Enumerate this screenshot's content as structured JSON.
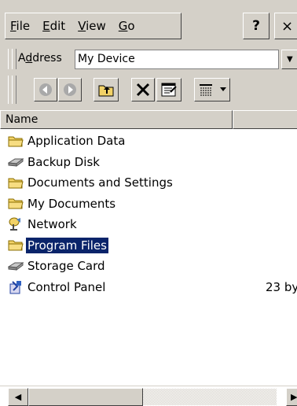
{
  "menu": {
    "items": [
      {
        "mnemonic": "F",
        "rest": "ile"
      },
      {
        "mnemonic": "E",
        "rest": "dit"
      },
      {
        "mnemonic": "V",
        "rest": "iew"
      },
      {
        "mnemonic": "G",
        "rest": "o"
      }
    ],
    "help_label": "?",
    "close_label": "×"
  },
  "address": {
    "label_prefix": "A",
    "label_mnemonic": "d",
    "label_rest": "dress",
    "value": "My Device",
    "dropdown_icon": "▼"
  },
  "toolbar": {
    "back_icon": "left-arrow-icon",
    "forward_icon": "right-arrow-icon",
    "up_icon": "folder-up-icon",
    "delete_icon": "delete-x-icon",
    "properties_icon": "properties-icon",
    "views_icon": "details-view-icon"
  },
  "columns": {
    "name": "Name",
    "size": ""
  },
  "files": [
    {
      "name": "Application Data",
      "icon": "folder-icon",
      "size": ""
    },
    {
      "name": "Backup Disk",
      "icon": "storage-card-icon",
      "size": ""
    },
    {
      "name": "Documents and Settings",
      "icon": "folder-icon",
      "size": ""
    },
    {
      "name": "My Documents",
      "icon": "folder-icon",
      "size": ""
    },
    {
      "name": "Network",
      "icon": "network-icon",
      "size": ""
    },
    {
      "name": "Program Files",
      "icon": "folder-icon",
      "size": "",
      "selected": true
    },
    {
      "name": "Storage Card",
      "icon": "storage-card-icon",
      "size": ""
    },
    {
      "name": "Control Panel",
      "icon": "control-panel-icon",
      "size": "23 by"
    }
  ],
  "scrollbar": {
    "left_arrow": "◀",
    "right_arrow": "▶"
  },
  "colors": {
    "chrome": "#d4d0c8",
    "selection": "#0a246a",
    "folder": "#f2d267"
  }
}
